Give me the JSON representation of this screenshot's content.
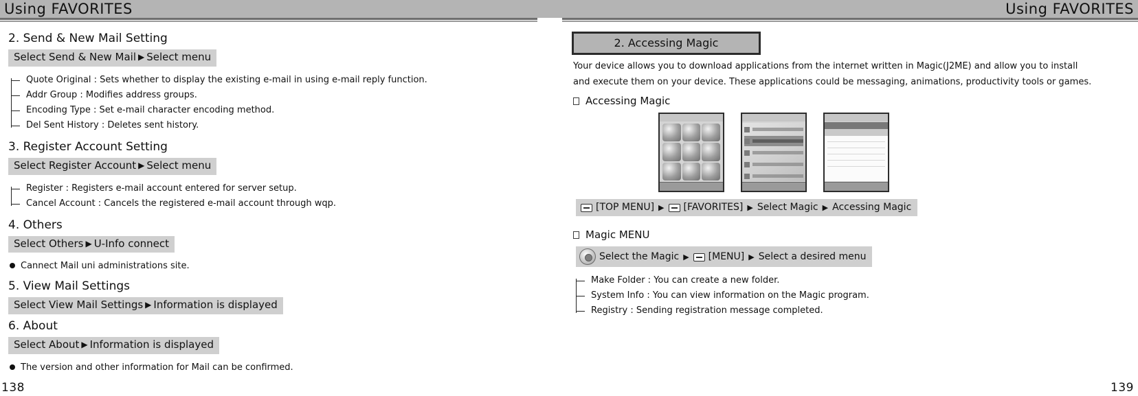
{
  "header": {
    "left_title": "Using FAVORITES",
    "right_title": "Using FAVORITES"
  },
  "page_numbers": {
    "left": "138",
    "right": "139"
  },
  "left_column": {
    "sections": [
      {
        "heading": "2. Send & New Mail Setting",
        "path_pre": "Select Send & New Mail",
        "path_post": "Select menu",
        "items": [
          "Quote Original : Sets whether to display the existing e-mail in using e-mail reply function.",
          "Addr Group : Modifies address groups.",
          "Encoding Type : Set e-mail character encoding method.",
          "Del Sent History : Deletes sent history."
        ]
      },
      {
        "heading": "3. Register Account Setting",
        "path_pre": "Select Register Account",
        "path_post": "Select menu",
        "items": [
          "Register : Registers e-mail account entered for server setup.",
          "Cancel Account : Cancels the registered e-mail account through wqp."
        ]
      },
      {
        "heading": "4. Others",
        "path_pre": "Select Others",
        "path_post": "U-Info connect",
        "bullets": [
          "Cannect Mail uni administrations site."
        ]
      },
      {
        "heading": "5. View Mail Settings",
        "path_pre": "Select View Mail Settings",
        "path_post": "Information is displayed"
      },
      {
        "heading": "6. About",
        "path_pre": "Select About",
        "path_post": "Information is displayed",
        "bullets": [
          "The version and other information for Mail can be confirmed."
        ]
      }
    ]
  },
  "right_column": {
    "callout": "2. Accessing Magic",
    "intro_line1": "Your device allows you to download applications from the internet written in Magic(J2ME) and allow you to install",
    "intro_line2": "and execute them on your device. These applications could be messaging, animations, productivity tools or games.",
    "sub1_heading": "Accessing Magic",
    "nav1": {
      "key1_label": "[TOP MENU]",
      "key2_label": "[FAVORITES]",
      "step3": "Select Magic",
      "step4": "Accessing Magic",
      "arrow": "▶"
    },
    "sub2_heading": "Magic MENU",
    "nav2": {
      "step1": "Select the Magic",
      "key_label": "[MENU]",
      "step2": "Select a desired menu",
      "arrow": "▶"
    },
    "magic_items": [
      "Make Folder : You can create a new folder.",
      "System Info : You can view information on the Magic program.",
      "Registry : Sending registration message completed."
    ]
  },
  "icons": {
    "arrow_right": "▶",
    "bullet_dot": "●"
  }
}
